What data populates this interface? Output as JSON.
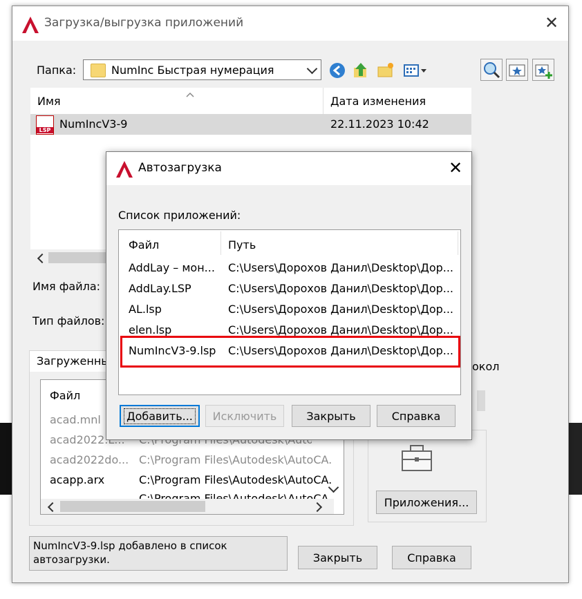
{
  "main_dialog": {
    "title": "Загрузка/выгрузка приложений",
    "folder_label": "Папка:",
    "folder_value": "NumInc Быстрая нумерация",
    "file_list": {
      "col_name": "Имя",
      "col_date": "Дата изменения",
      "rows": [
        {
          "name": "NumIncV3-9",
          "date": "22.11.2023 10:42",
          "icon": "lsp-file-icon",
          "icon_text": "LSP"
        }
      ]
    },
    "filename_label": "Имя файла:",
    "filetype_label": "Тип файлов:",
    "loaded_tab_label": "Загруженные",
    "history_partial": "окол",
    "loaded_list": {
      "col_file": "Файл",
      "rows": [
        {
          "file": "acad.mnl",
          "path": ""
        },
        {
          "file": "acad2022.L...",
          "path": "C:\\Program Files\\Autodesk\\AutoCA..."
        },
        {
          "file": "acad2022do...",
          "path": "C:\\Program Files\\Autodesk\\AutoCA."
        },
        {
          "file": "acapp.arx",
          "path": "C:\\Program Files\\Autodesk\\AutoCA."
        },
        {
          "file": "",
          "path": "C:\\Program Files\\Autodesk\\AutoCA..."
        }
      ]
    },
    "apps_button": "Приложения...",
    "status_text": "NumIncV3-9.lsp добавлено в список автозагрузки.",
    "close_button": "Закрыть",
    "help_button": "Справка"
  },
  "autoload_dialog": {
    "title": "Автозагрузка",
    "list_label": "Список приложений:",
    "col_file": "Файл",
    "col_path": "Путь",
    "rows": [
      {
        "file": "AddLay – мон...",
        "path": "C:\\Users\\Дорохов Данил\\Desktop\\Дор..."
      },
      {
        "file": "AddLay.LSP",
        "path": "C:\\Users\\Дорохов Данил\\Desktop\\Дор..."
      },
      {
        "file": "AL.lsp",
        "path": "C:\\Users\\Дорохов Данил\\Desktop\\Дор..."
      },
      {
        "file": "elen.lsp",
        "path": "C:\\Users\\Дорохов Данил\\Desktop\\Дор..."
      },
      {
        "file": "NumIncV3-9.lsp",
        "path": "C:\\Users\\Дорохов Данил\\Desktop\\Дор..."
      }
    ],
    "add_button": "Добавить...",
    "remove_button": "Исключить",
    "close_button": "Закрыть",
    "help_button": "Справка"
  },
  "colors": {
    "autocad_red": "#c8102e",
    "highlight_red": "#e8000b",
    "dialog_bg": "#f0f0f0",
    "focus_blue": "#0078d7"
  }
}
